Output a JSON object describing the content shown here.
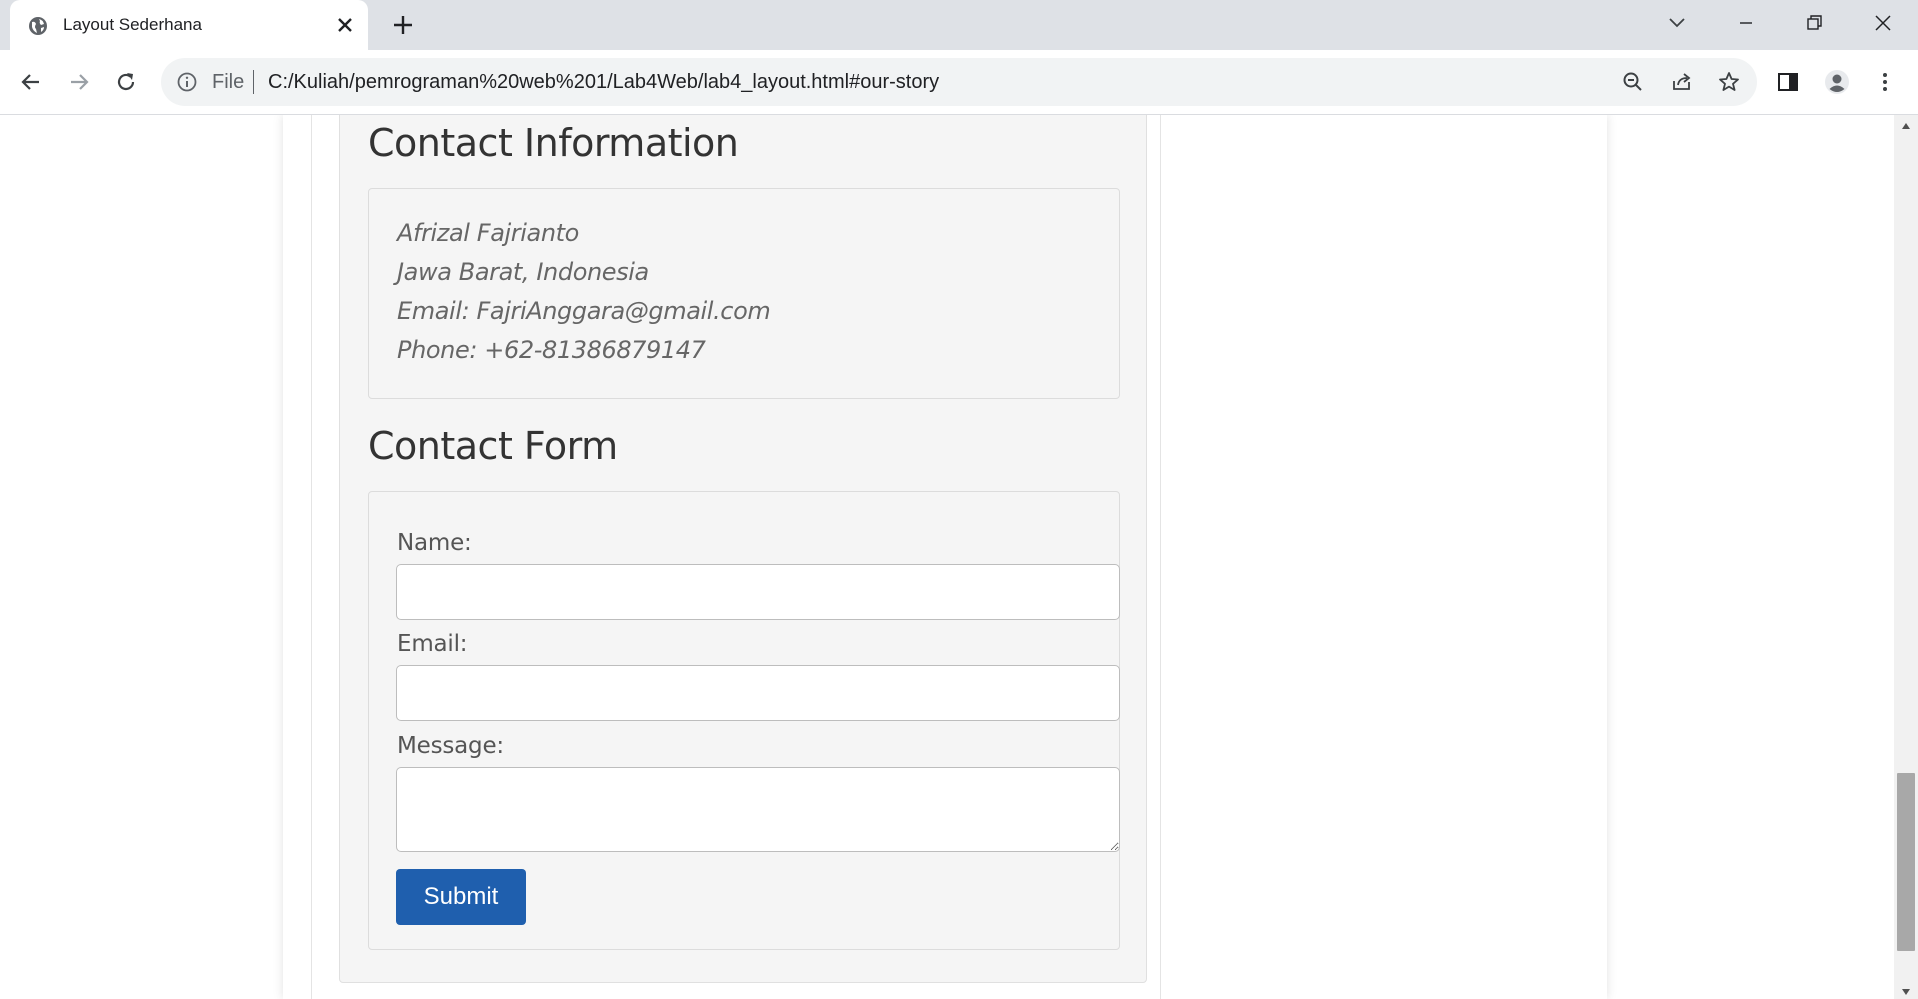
{
  "browser": {
    "tab_title": "Layout Sederhana",
    "omnibox_scheme_label": "File",
    "url": "C:/Kuliah/pemrograman%20web%201/Lab4Web/lab4_layout.html#our-story"
  },
  "page": {
    "contact_info": {
      "heading": "Contact Information",
      "lines": [
        "Afrizal Fajrianto",
        "Jawa Barat, Indonesia",
        "Email: FajriAnggara@gmail.com",
        "Phone: +62-81386879147"
      ]
    },
    "contact_form": {
      "heading": "Contact Form",
      "name_label": "Name:",
      "name_value": "",
      "email_label": "Email:",
      "email_value": "",
      "message_label": "Message:",
      "message_value": "",
      "submit_label": "Submit"
    }
  },
  "colors": {
    "submit_bg": "#1f5fae",
    "section_bg": "#f5f5f5",
    "chrome_bg": "#dee1e6"
  }
}
